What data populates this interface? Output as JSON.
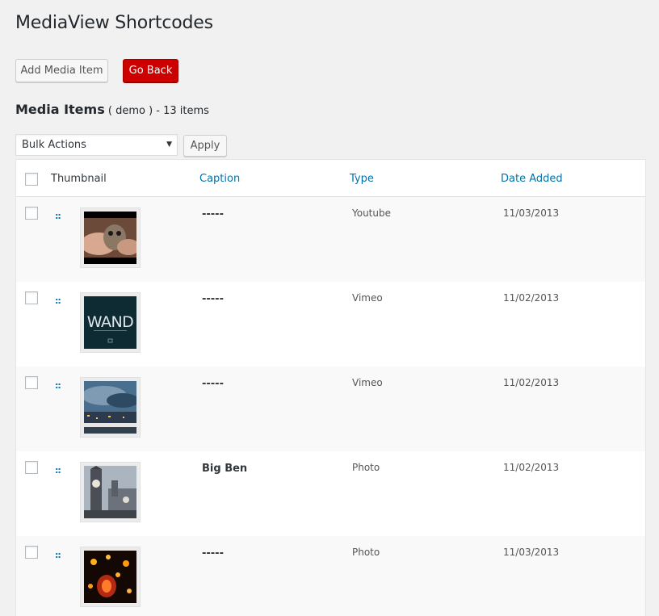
{
  "page": {
    "title": "MediaView Shortcodes"
  },
  "toolbar": {
    "add_label": "Add Media Item",
    "back_label": "Go Back"
  },
  "section": {
    "heading": "Media Items",
    "context": "( demo )",
    "count": "- 13 items"
  },
  "bulk": {
    "selected": "Bulk Actions",
    "apply_label": "Apply"
  },
  "table": {
    "headers": {
      "thumbnail": "Thumbnail",
      "caption": "Caption",
      "type": "Type",
      "date": "Date Added"
    },
    "rows": [
      {
        "caption": "-----",
        "type": "Youtube",
        "date": "11/03/2013",
        "thumb": "owl"
      },
      {
        "caption": "-----",
        "type": "Vimeo",
        "date": "11/02/2013",
        "thumb": "wand",
        "thumb_text": "WAND"
      },
      {
        "caption": "-----",
        "type": "Vimeo",
        "date": "11/02/2013",
        "thumb": "city-sky"
      },
      {
        "caption": "Big Ben",
        "type": "Photo",
        "date": "11/02/2013",
        "thumb": "big-ben"
      },
      {
        "caption": "-----",
        "type": "Photo",
        "date": "11/03/2013",
        "thumb": "lanterns"
      }
    ]
  },
  "colors": {
    "link": "#0073aa",
    "back_button": "#cc0000",
    "background": "#f1f1f1"
  }
}
